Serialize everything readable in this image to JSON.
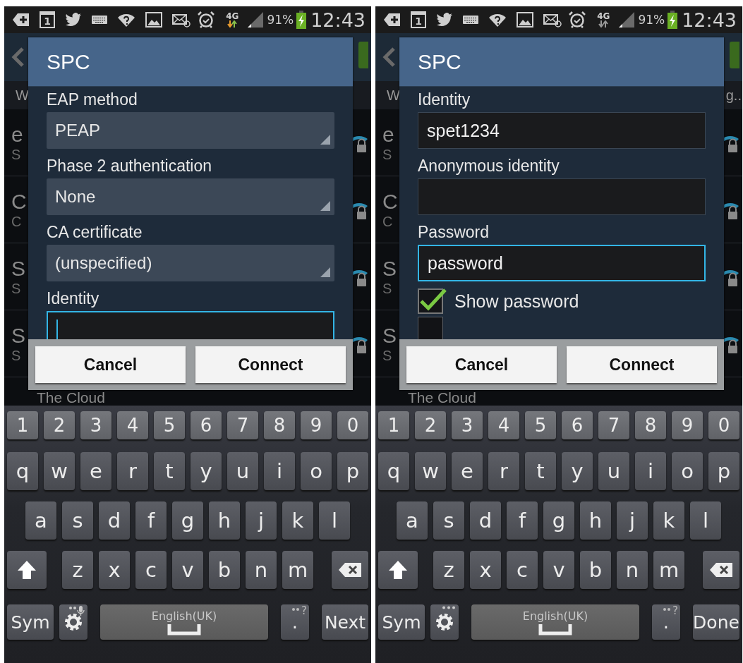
{
  "phones": [
    {
      "status_bar": {
        "calendar_day": "1",
        "network": "4G",
        "data_active": true,
        "battery": "91%",
        "time": "12:43"
      },
      "background": {
        "subheader": "W",
        "rows": [
          {
            "title": "e",
            "subtitle": "S"
          },
          {
            "title": "C",
            "subtitle": "C"
          },
          {
            "title": "S",
            "subtitle": "S"
          },
          {
            "title": "S",
            "subtitle": "S"
          }
        ],
        "last_row": "The Cloud"
      },
      "dialog": {
        "title": "SPC",
        "fields": [
          {
            "kind": "spinner",
            "label": "EAP method",
            "value": "PEAP"
          },
          {
            "kind": "spinner",
            "label": "Phase 2 authentication",
            "value": "None"
          },
          {
            "kind": "spinner",
            "label": "CA certificate",
            "value": "(unspecified)"
          },
          {
            "kind": "input",
            "label": "Identity",
            "focused": true,
            "cursor": true
          }
        ],
        "buttons": [
          "Cancel",
          "Connect"
        ]
      },
      "keyboard": {
        "rows": [
          {
            "kind": "digits",
            "keys": [
              "1",
              "2",
              "3",
              "4",
              "5",
              "6",
              "7",
              "8",
              "9",
              "0"
            ]
          },
          {
            "kind": "letters",
            "keys": [
              "q",
              "w",
              "e",
              "r",
              "t",
              "y",
              "u",
              "i",
              "o",
              "p"
            ]
          },
          {
            "kind": "letters",
            "keys": [
              "a",
              "s",
              "d",
              "f",
              "g",
              "h",
              "j",
              "k",
              "l"
            ]
          },
          {
            "kind": "shift_row",
            "keys": [
              "z",
              "x",
              "c",
              "v",
              "b",
              "n",
              "m"
            ]
          },
          {
            "kind": "bottom",
            "sym": "Sym",
            "mic": true,
            "space": "English(UK)",
            "period": ".",
            "period_hint": "?",
            "action": "Next"
          }
        ]
      }
    },
    {
      "status_bar": {
        "calendar_day": "1",
        "network": "4G",
        "data_active": false,
        "battery": "91%",
        "time": "12:43"
      },
      "background": {
        "subheader": "W",
        "subheader_right": "g..",
        "rows": [
          {
            "title": "e",
            "subtitle": "S"
          },
          {
            "title": "C",
            "subtitle": "C"
          },
          {
            "title": "S",
            "subtitle": "S"
          },
          {
            "title": "S",
            "subtitle": "S"
          }
        ],
        "last_row": "The Cloud"
      },
      "dialog": {
        "title": "SPC",
        "fields": [
          {
            "kind": "input",
            "label": "Identity",
            "value": "spet1234",
            "focused": false,
            "cursor": false
          },
          {
            "kind": "input",
            "label": "Anonymous identity",
            "focused": false,
            "cursor": false
          },
          {
            "kind": "input",
            "label": "Password",
            "value": "password",
            "focused": true,
            "cursor": false
          },
          {
            "kind": "checkbox",
            "label": "Show password",
            "checked": true
          },
          {
            "kind": "checkbox",
            "checked": false
          }
        ],
        "buttons": [
          "Cancel",
          "Connect"
        ]
      },
      "keyboard": {
        "rows": [
          {
            "kind": "digits",
            "keys": [
              "1",
              "2",
              "3",
              "4",
              "5",
              "6",
              "7",
              "8",
              "9",
              "0"
            ]
          },
          {
            "kind": "letters",
            "keys": [
              "q",
              "w",
              "e",
              "r",
              "t",
              "y",
              "u",
              "i",
              "o",
              "p"
            ]
          },
          {
            "kind": "letters",
            "keys": [
              "a",
              "s",
              "d",
              "f",
              "g",
              "h",
              "j",
              "k",
              "l"
            ]
          },
          {
            "kind": "shift_row",
            "keys": [
              "z",
              "x",
              "c",
              "v",
              "b",
              "n",
              "m"
            ]
          },
          {
            "kind": "bottom",
            "sym": "Sym",
            "mic": false,
            "space": "English(UK)",
            "period": ".",
            "period_hint": "?",
            "action": "Done"
          }
        ]
      }
    }
  ]
}
